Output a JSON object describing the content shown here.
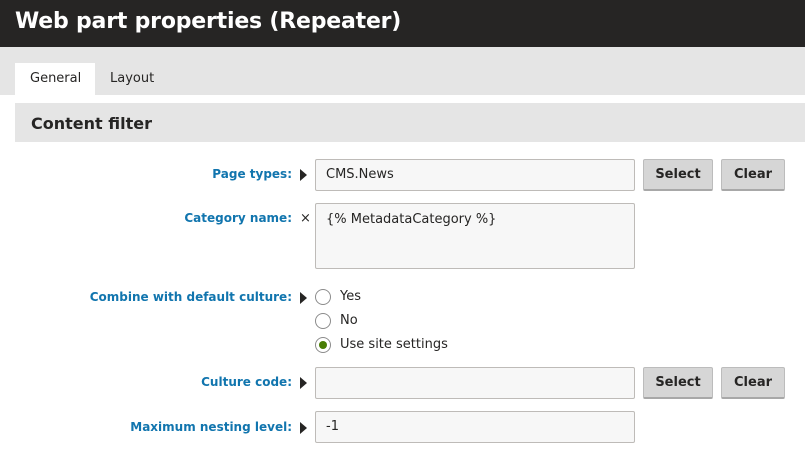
{
  "window": {
    "title": "Web part properties (Repeater)"
  },
  "tabs": [
    {
      "label": "General",
      "active": true
    },
    {
      "label": "Layout",
      "active": false
    }
  ],
  "section": {
    "title": "Content filter"
  },
  "fields": {
    "page_types": {
      "label": "Page types:",
      "value": "CMS.News",
      "marker": "arrow-icon",
      "select_label": "Select",
      "clear_label": "Clear"
    },
    "category_name": {
      "label": "Category name:",
      "value": "{% MetadataCategory %}",
      "marker": "×"
    },
    "combine_culture": {
      "label": "Combine with default culture:",
      "marker": "arrow-icon",
      "options": [
        {
          "label": "Yes",
          "selected": false
        },
        {
          "label": "No",
          "selected": false
        },
        {
          "label": "Use site settings",
          "selected": true
        }
      ]
    },
    "culture_code": {
      "label": "Culture code:",
      "value": "",
      "marker": "arrow-icon",
      "select_label": "Select",
      "clear_label": "Clear"
    },
    "max_nesting": {
      "label": "Maximum nesting level:",
      "value": "-1",
      "marker": "arrow-icon"
    }
  },
  "colors": {
    "titlebar": "#262524",
    "label": "#1175ae",
    "radio_selected": "#497d04",
    "panel": "#e5e5e5"
  }
}
